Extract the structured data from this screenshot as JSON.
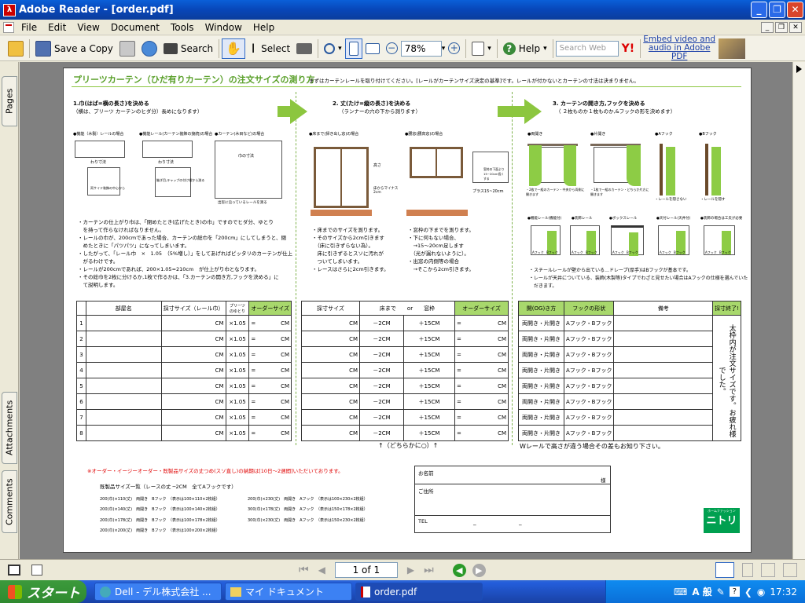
{
  "window": {
    "title": "Adobe Reader - [order.pdf]",
    "app_icon": "adobe-reader-icon"
  },
  "menu": [
    "File",
    "Edit",
    "View",
    "Document",
    "Tools",
    "Window",
    "Help"
  ],
  "toolbar": {
    "save_copy": "Save a Copy",
    "search": "Search",
    "select": "Select",
    "zoom": "78%",
    "help": "Help",
    "search_web_placeholder": "Search Web",
    "embed_line1": "Embed video and",
    "embed_line2": "audio in Adobe PDF"
  },
  "sidetabs": {
    "pages": "Pages",
    "attachments": "Attachments",
    "comments": "Comments"
  },
  "status": {
    "page": "1 of 1"
  },
  "taskbar": {
    "start": "スタート",
    "tasks": [
      "Dell - デル株式会社 ...",
      "マイ ドキュメント",
      "order.pdf"
    ],
    "time": "17:32",
    "ime": "A 般"
  },
  "doc": {
    "title": "プリーツカーテン（ひだ有りカーテン）の注文サイズの測り方",
    "intro": "まずはカーテンレールを取り付けてください。[レールがカーテンサイズ決定の基準]です。レールが付かないとカーテンの寸法は決まりません。",
    "step1": "1.巾(はば=横の長さ)を決める",
    "step1b": "（横は、プリーツ カーテンのヒダ分）長めになります）",
    "step2": "2. 丈(たけ=縦の長さ)を決める",
    "step2b": "（ランナーの穴の下から測ります）",
    "step3": "3. カーテンの開き方,フックを決める",
    "step3b": "（ ２枚ものか１枚ものか,&フックの形を決めます）",
    "s1_labels": [
      "●機能（木製）レールの場合",
      "●機能レール(カーテン装飾の接続)の場合",
      "●カーテン(木目など)の場合"
    ],
    "s1_notes": [
      "わり寸法",
      "わり寸法",
      "巾の寸法",
      "両サイド装飾の中心から",
      "継ぎ目,キャップの付け根から測る",
      "出窓に沿っているレールを測る"
    ],
    "s2_labels": [
      "●床まで(掃き出し窓)の場合",
      "●腰窓(腰高窓)の場合"
    ],
    "s2_notes": [
      "高さ",
      "床からマイナス2cm",
      "窓枠の下面より15~20cm長くする",
      "プラス15~20cm"
    ],
    "s3_labels": [
      "●両開き",
      "●片開き",
      "●Aフック",
      "●Bフック"
    ],
    "s3_notes": [
      "・2枚で一組のカーテン・中央から両側に開きます",
      "・1枚で一組のカーテン・どちらか片方に開きます",
      "・レールを隠さない",
      "・レールを隠す"
    ],
    "s3_rails": [
      "●機能レール(機能付)",
      "●装飾レール",
      "●ボックスレール",
      "●天付レール(天井付)",
      "●装飾の場合は工夫が必要"
    ],
    "s3_fook": [
      "Aフック",
      "Bフック",
      "Aフック",
      "Bフック",
      "Aフック",
      "Bフック",
      "Aフック",
      "Bフック",
      "Aフック",
      "Bフック"
    ],
    "notes1": [
      "・カーテンの仕上がり巾は、「閉めたとき(広げたとき)の巾」ですのでヒダ分、ゆとり",
      "　を持って作らなければなりません。",
      "・レールの巾が、200cmであった場合、カーテンの総巾を「200cm」にしてしまうと、閉",
      "　めたときに「パツパツ」になってしまいます。",
      "・したがって、「レール巾　×　1.05　（5%増し）」をしてあげればピッタリのカーテンが仕上",
      "　がるわけです。",
      "・レールが200cmであれば、200×1.05=210cm　が仕上がり巾となります。",
      "・その総巾を2枚に分けるか,1枚で作るかは、「3.カーテンの開き方,フックを決める」に",
      "　て説明します。"
    ],
    "notes2": [
      "・床までのサイズを測ります。",
      "・そのサイズから2cm引きます",
      "　（床に引きずらない為）。",
      "　床に引きずるとスソに汚れが",
      "　ついてしまいます。",
      "・レースはさらに2cm引きます。"
    ],
    "notes2b": [
      "・窓枠の下までを測ります。",
      "・下に何もない場合、",
      "　→15～20cm足します",
      "　（光が漏れないように）。",
      "・出窓の内側等の場合",
      "　→そこから2cm引きます。"
    ],
    "notes3": [
      "・スチールレールが壁から出ている…ドレープ(厚手)はBフックが基本です。",
      "・レールが天井についている、装飾(木製等)タイプでわざと見せたい場合はAフックの仕様を選んでいた",
      "　だきます。"
    ],
    "table": {
      "h1": [
        "部屋名",
        "採寸サイズ（レール巾）",
        "プリーツのゆとり",
        "オーダーサイズ"
      ],
      "h2": [
        "採寸サイズ",
        "床まで　　or　　窓枠",
        "オーダーサイズ"
      ],
      "h3": [
        "開(OG)き方",
        "フックの形状",
        "備考",
        "採寸終了!"
      ],
      "rows": [
        "1",
        "2",
        "3",
        "4",
        "5",
        "6",
        "7",
        "8"
      ],
      "cm": "CM",
      "mult": "×1.05",
      "eq": "=",
      "minus": "－2CM",
      "plus": "＋15CM",
      "open": "両開き・片開き",
      "hook": "Aフック・Bフック",
      "side_note": "太枠内が注文サイズです。お疲れ様でした。"
    },
    "below_mid": "↑（どちらかに○）↑",
    "below_right": "Wレールで高さが違う場合その差もお知り下さい。",
    "warn": "※オーダー・イージーオーダー・既製品サイズの丈つめ(スソ直し)の納期は[10日～2週間]いただいております。",
    "ready_title": "既製品サイズ一覧（レースの丈 ─2CM　全てAフックです）",
    "ready": [
      "200(巾)×110(丈)　両開き　Bフック　（表示は100×110×2枚組）",
      "200(巾)×140(丈)　両開き　Bフック　（表示は100×140×2枚組）",
      "200(巾)×178(丈)　両開き　Bフック　（表示は100×178×2枚組）",
      "200(巾)×200(丈)　両開き　Bフック　（表示は100×200×2枚組）",
      "200(巾)×230(丈)　両開き　Aフック　（表示は100×230×2枚組）",
      "300(巾)×178(丈)　両開き　Aフック　（表示は150×178×2枚組）",
      "300(巾)×230(丈)　両開き　Aフック　（表示は150×230×2枚組）"
    ],
    "form": {
      "name": "お名前",
      "sama": "様",
      "address": "ご住所",
      "tel": "TEL",
      "dash1": "─",
      "dash2": "─"
    },
    "logo_sub": "ホームファッション",
    "logo": "ニトリ"
  },
  "colors": {
    "accent_green": "#8cc63f",
    "title_blue": "#0846b8",
    "warn_red": "#e00000",
    "logo_green": "#00a050"
  }
}
